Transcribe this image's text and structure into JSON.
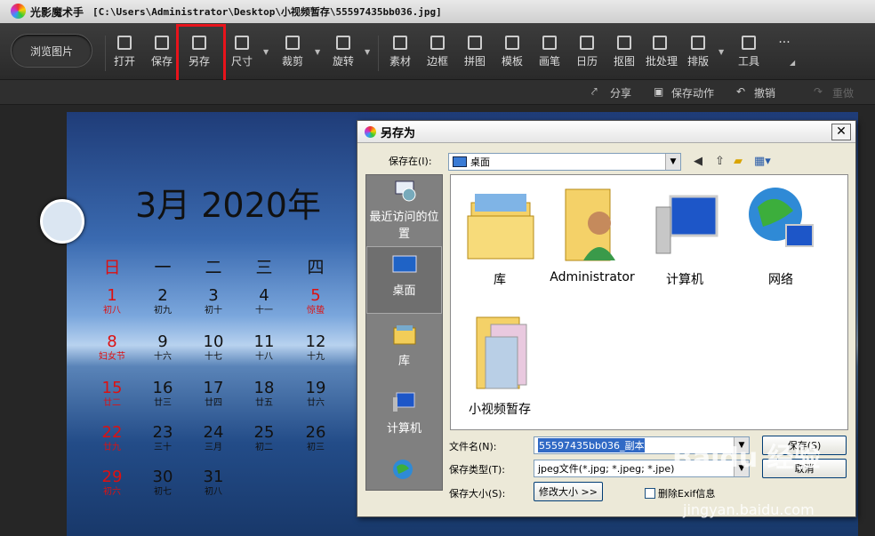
{
  "app": {
    "title": "光影魔术手",
    "path": "[C:\\Users\\Administrator\\Desktop\\小视频暂存\\55597435bb036.jpg]"
  },
  "toolbar": {
    "browse_label": "浏览图片",
    "tools": [
      "打开",
      "保存",
      "另存",
      "尺寸",
      "裁剪",
      "旋转",
      "素材",
      "边框",
      "拼图",
      "模板",
      "画笔",
      "日历",
      "抠图",
      "批处理",
      "排版",
      "工具"
    ],
    "more": "···"
  },
  "subbar": {
    "share": "分享",
    "save_action": "保存动作",
    "undo": "撤销",
    "redo": "重做"
  },
  "calendar": {
    "title": "3月 2020年",
    "weekdays": [
      "日",
      "一",
      "二",
      "三",
      "四"
    ],
    "rows": [
      [
        {
          "n": "1",
          "l": "初八"
        },
        {
          "n": "2",
          "l": "初九"
        },
        {
          "n": "3",
          "l": "初十"
        },
        {
          "n": "4",
          "l": "十一"
        },
        {
          "n": "5",
          "l": "惊蛰"
        }
      ],
      [
        {
          "n": "8",
          "l": "妇女节"
        },
        {
          "n": "9",
          "l": "十六"
        },
        {
          "n": "10",
          "l": "十七"
        },
        {
          "n": "11",
          "l": "十八"
        },
        {
          "n": "12",
          "l": "十九"
        }
      ],
      [
        {
          "n": "15",
          "l": "廿二"
        },
        {
          "n": "16",
          "l": "廿三"
        },
        {
          "n": "17",
          "l": "廿四"
        },
        {
          "n": "18",
          "l": "廿五"
        },
        {
          "n": "19",
          "l": "廿六"
        }
      ],
      [
        {
          "n": "22",
          "l": "廿九"
        },
        {
          "n": "23",
          "l": "三十"
        },
        {
          "n": "24",
          "l": "三月"
        },
        {
          "n": "25",
          "l": "初二"
        },
        {
          "n": "26",
          "l": "初三"
        }
      ],
      [
        {
          "n": "29",
          "l": "初六"
        },
        {
          "n": "30",
          "l": "初七"
        },
        {
          "n": "31",
          "l": "初八"
        }
      ]
    ]
  },
  "dialog": {
    "title": "另存为",
    "save_in_label": "保存在(I):",
    "save_in_value": "桌面",
    "places": [
      "最近访问的位置",
      "桌面",
      "库",
      "计算机"
    ],
    "files": [
      "库",
      "Administrator",
      "计算机",
      "网络",
      "小视频暂存"
    ],
    "filename_label": "文件名(N):",
    "filename_value": "55597435bb036_副本",
    "filetype_label": "保存类型(T):",
    "filetype_value": "jpeg文件(*.jpg; *.jpeg; *.jpe)",
    "size_label": "保存大小(S):",
    "resize_btn": "修改大小 >>",
    "exif_label": "删除Exif信息",
    "save_btn": "保存(S)",
    "cancel_btn": "取消"
  },
  "watermark": {
    "brand": "Baidu 经验",
    "url": "jingyan.baidu.com"
  }
}
